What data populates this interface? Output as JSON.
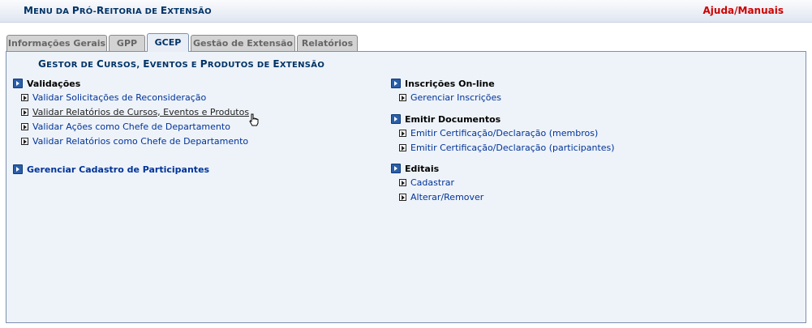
{
  "header": {
    "title_first": "M",
    "title_rest": "ENU DA ",
    "title_p": "P",
    "title_pro": "RÓ-",
    "title_r": "R",
    "title_eitoria": "EITORIA DE ",
    "title_e": "E",
    "title_xtensao": "XTENSÃO",
    "help": "Ajuda/Manuais"
  },
  "tabs": [
    "Informações Gerais",
    "GPP",
    "GCEP",
    "Gestão de Extensão",
    "Relatórios"
  ],
  "panel": {
    "title_parts": [
      "G",
      "ESTOR DE ",
      "C",
      "URSOS, ",
      "E",
      "VENTOS E ",
      "P",
      "RODUTOS DE ",
      "E",
      "XTENSÃO"
    ]
  },
  "left": {
    "validacoes": {
      "heading": "Validações",
      "items": [
        "Validar Solicitações de Reconsideração",
        "Validar Relatórios de Cursos, Eventos e Produtos",
        "Validar Ações como Chefe de Departamento",
        "Validar Relatórios como Chefe de Departamento"
      ]
    },
    "gerenciar": {
      "heading": "Gerenciar Cadastro de Participantes"
    }
  },
  "right": {
    "inscricoes": {
      "heading": "Inscrições On-line",
      "items": [
        "Gerenciar Inscrições"
      ]
    },
    "emitir": {
      "heading": "Emitir Documentos",
      "items": [
        "Emitir Certificação/Declaração (membros)",
        "Emitir Certificação/Declaração (participantes)"
      ]
    },
    "editais": {
      "heading": "Editais",
      "items": [
        "Cadastrar",
        "Alterar/Remover"
      ]
    }
  },
  "icons": {
    "section": "blue-arrow-square-icon",
    "item": "arrow-box-icon",
    "cursor": "hand-pointer-cursor"
  },
  "colors": {
    "header_title": "#003366",
    "help": "#cc0000",
    "link": "#003399",
    "panel_bg": "#eef3f9"
  }
}
